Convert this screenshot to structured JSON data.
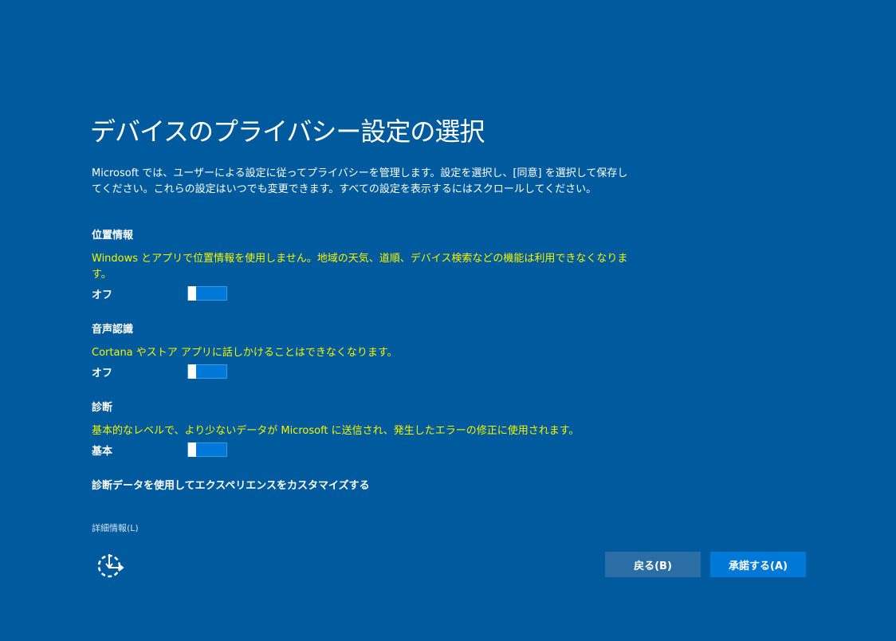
{
  "title": "デバイスのプライバシー設定の選択",
  "intro": "Microsoft では、ユーザーによる設定に従ってプライバシーを管理します。設定を選択し、[同意] を選択して保存してください。これらの設定はいつでも変更できます。すべての設定を表示するにはスクロールしてください。",
  "sections": [
    {
      "heading": "位置情報",
      "description": "Windows とアプリで位置情報を使用しません。地域の天気、道順、デバイス検索などの機能は利用できなくなります。",
      "state_label": "オフ",
      "toggle_on": false
    },
    {
      "heading": "音声認識",
      "description": "Cortana やストア アプリに話しかけることはできなくなります。",
      "state_label": "オフ",
      "toggle_on": false
    },
    {
      "heading": "診断",
      "description": "基本的なレベルで、より少ないデータが Microsoft に送信され、発生したエラーの修正に使用されます。",
      "state_label": "基本",
      "toggle_on": false
    },
    {
      "heading": "診断データを使用してエクスペリエンスをカスタマイズする"
    }
  ],
  "more_info_link": "詳細情報(L)",
  "buttons": {
    "back": "戻る(B)",
    "accept": "承諾する(A)"
  },
  "icons": {
    "accessibility": "ease-of-access-icon"
  },
  "colors": {
    "background": "#005a9e",
    "accent": "#0078d7",
    "highlight_text": "#f5f500"
  }
}
